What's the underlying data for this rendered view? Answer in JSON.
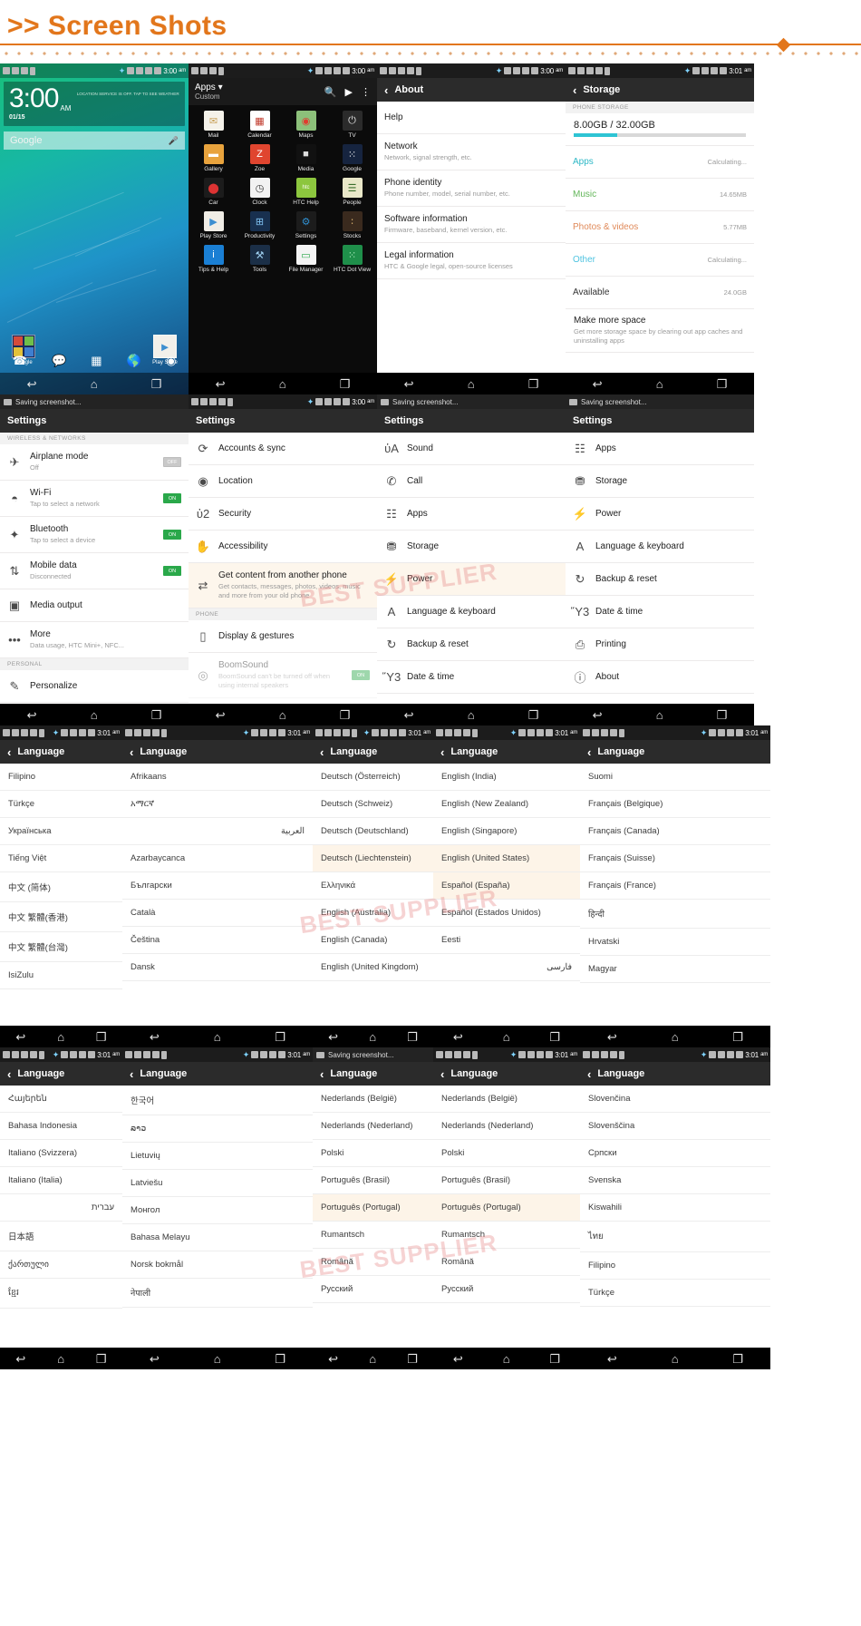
{
  "page": {
    "heading": ">> Screen Shots",
    "chevron": ">>"
  },
  "watermarks": [
    "BEST SUPPLIER",
    "BEST SUPPLIER",
    "BEST SUPPLIER"
  ],
  "status_bar": {
    "time_300": "3:00",
    "time_301": "3:01",
    "ampm": "am"
  },
  "toast": {
    "label": "Saving screenshot..."
  },
  "navbar": {
    "back": "↩",
    "home": "⌂",
    "recent": "❐"
  },
  "home": {
    "clock_time": "3:00",
    "clock_ampm": "AM",
    "clock_date": "01/15",
    "weather_note": "LOCATION SERVICE IS OFF. TAP TO SEE WEATHER",
    "search_placeholder": "Google",
    "mic_icon": "mic-icon",
    "folder_label": "Google",
    "playstore_label": "Play Store",
    "dock": [
      "phone-icon",
      "messages-icon",
      "all-apps-icon",
      "browser-icon",
      "camera-icon"
    ]
  },
  "drawer": {
    "title": "Apps",
    "subtitle": "Custom",
    "caret": "▾",
    "search_icon": "search-icon",
    "store_icon": "play-store-icon",
    "overflow_icon": "overflow-menu-icon",
    "apps": [
      {
        "name": "Mail",
        "color": "#f5f2ea",
        "glyph": "✉",
        "fg": "#c9a25a"
      },
      {
        "name": "Calendar",
        "color": "#ffffff",
        "glyph": "▦",
        "fg": "#c0392b"
      },
      {
        "name": "Maps",
        "color": "#8cc07a",
        "glyph": "◉",
        "fg": "#e03b2f"
      },
      {
        "name": "TV",
        "color": "#2b2b2b",
        "glyph": "⏻",
        "fg": "#e8e8e8"
      },
      {
        "name": "Gallery",
        "color": "#e8a33d",
        "glyph": "▬",
        "fg": "#fff"
      },
      {
        "name": "Zoe",
        "color": "#e0452f",
        "glyph": "Z",
        "fg": "#fff"
      },
      {
        "name": "Media",
        "color": "#111111",
        "glyph": "■",
        "fg": "#dddddd"
      },
      {
        "name": "Google",
        "color": "#16243f",
        "glyph": "⁙",
        "fg": "#ffffff"
      },
      {
        "name": "Car",
        "color": "#1c1c1c",
        "glyph": "⬤",
        "fg": "#d33"
      },
      {
        "name": "Clock",
        "color": "#f2f2f2",
        "glyph": "◷",
        "fg": "#333"
      },
      {
        "name": "HTC Help",
        "color": "#8cc63e",
        "glyph": "htc",
        "fg": "#ffffff"
      },
      {
        "name": "People",
        "color": "#e9e7c8",
        "glyph": "☰",
        "fg": "#3b6e2c"
      },
      {
        "name": "Play Store",
        "color": "#f0ede6",
        "glyph": "▶",
        "fg": "#3c8ed0"
      },
      {
        "name": "Productivity",
        "color": "#18304f",
        "glyph": "⊞",
        "fg": "#7fc1f0"
      },
      {
        "name": "Settings",
        "color": "#1c1c1c",
        "glyph": "⚙",
        "fg": "#2f8fd0"
      },
      {
        "name": "Stocks",
        "color": "#3a2a1e",
        "glyph": "∶",
        "fg": "#cfa86a"
      },
      {
        "name": "Tips & Help",
        "color": "#1a7fd4",
        "glyph": "i",
        "fg": "#ffffff"
      },
      {
        "name": "Tools",
        "color": "#1b2f47",
        "glyph": "⚒",
        "fg": "#9fd0f0"
      },
      {
        "name": "File Manager",
        "color": "#f4f4f4",
        "glyph": "▭",
        "fg": "#2aa84a"
      },
      {
        "name": "HTC Dot View",
        "color": "#1f8f4a",
        "glyph": "⁙",
        "fg": "#b9f5c9"
      }
    ]
  },
  "about_screen": {
    "title": "About",
    "back_icon": "back-chevron-icon",
    "items": [
      {
        "title": "Help",
        "subtitle": ""
      },
      {
        "title": "Network",
        "subtitle": "Network, signal strength, etc."
      },
      {
        "title": "Phone identity",
        "subtitle": "Phone number, model, serial number, etc."
      },
      {
        "title": "Software information",
        "subtitle": "Firmware, baseband, kernel version, etc."
      },
      {
        "title": "Legal information",
        "subtitle": "HTC & Google legal, open-source licenses"
      }
    ]
  },
  "storage_screen": {
    "title": "Storage",
    "back_icon": "back-chevron-icon",
    "section_header": "PHONE STORAGE",
    "usage_label": "8.00GB / 32.00GB",
    "usage_percent": 25,
    "items": [
      {
        "label": "Apps",
        "value": "Calculating...",
        "color": "#2eb8c6"
      },
      {
        "label": "Music",
        "value": "14.65MB",
        "color": "#63b65a"
      },
      {
        "label": "Photos & videos",
        "value": "5.77MB",
        "color": "#e08a5a"
      },
      {
        "label": "Other",
        "value": "Calculating...",
        "color": "#4fc3e0"
      },
      {
        "label": "Available",
        "value": "24.0GB",
        "color": "#333333"
      }
    ],
    "make_space": {
      "title": "Make more space",
      "subtitle": "Get more storage space by clearing out app caches and uninstalling apps"
    }
  },
  "settings_1": {
    "title": "Settings",
    "section_wireless": "WIRELESS & NETWORKS",
    "section_personal": "PERSONAL",
    "items": [
      {
        "icon": "airplane-icon",
        "title": "Airplane mode",
        "subtitle": "Off",
        "toggle": "OFF",
        "on": false
      },
      {
        "icon": "wifi-icon",
        "title": "Wi-Fi",
        "subtitle": "Tap to select a network",
        "toggle": "ON",
        "on": true
      },
      {
        "icon": "bluetooth-icon",
        "title": "Bluetooth",
        "subtitle": "Tap to select a device",
        "toggle": "ON",
        "on": true
      },
      {
        "icon": "mobiledata-icon",
        "title": "Mobile data",
        "subtitle": "Disconnected",
        "toggle": "ON",
        "on": true
      },
      {
        "icon": "mediaoutput-icon",
        "title": "Media output",
        "subtitle": "",
        "toggle": "",
        "on": false
      },
      {
        "icon": "more-icon",
        "title": "More",
        "subtitle": "Data usage, HTC Mini+, NFC...",
        "toggle": "",
        "on": false
      }
    ],
    "personal_items": [
      {
        "icon": "personalize-icon",
        "title": "Personalize",
        "subtitle": ""
      }
    ]
  },
  "settings_2": {
    "title": "Settings",
    "section_phone": "PHONE",
    "items": [
      {
        "icon": "accounts-sync-icon",
        "title": "Accounts & sync",
        "subtitle": ""
      },
      {
        "icon": "location-pin-icon",
        "title": "Location",
        "subtitle": ""
      },
      {
        "icon": "lock-icon",
        "title": "Security",
        "subtitle": ""
      },
      {
        "icon": "hand-icon",
        "title": "Accessibility",
        "subtitle": ""
      },
      {
        "icon": "transfer-icon",
        "title": "Get content from another phone",
        "subtitle": "Get contacts, messages, photos, videos, music and more from your old phone",
        "highlight": true
      }
    ],
    "phone_items": [
      {
        "icon": "display-icon",
        "title": "Display & gestures",
        "subtitle": ""
      },
      {
        "icon": "boomsound-icon",
        "title": "BoomSound",
        "subtitle": "BoomSound can't be turned off when using internal speakers",
        "toggle": "ON",
        "on": true,
        "dim": true
      }
    ]
  },
  "settings_3": {
    "title": "Settings",
    "items": [
      {
        "icon": "sound-icon",
        "title": "Sound"
      },
      {
        "icon": "call-icon",
        "title": "Call"
      },
      {
        "icon": "apps-icon",
        "title": "Apps"
      },
      {
        "icon": "storage-icon",
        "title": "Storage"
      },
      {
        "icon": "power-icon",
        "title": "Power",
        "highlight": true
      },
      {
        "icon": "language-icon",
        "title": "Language & keyboard"
      },
      {
        "icon": "backup-icon",
        "title": "Backup & reset"
      },
      {
        "icon": "datetime-icon",
        "title": "Date & time"
      }
    ]
  },
  "settings_4": {
    "title": "Settings",
    "items": [
      {
        "icon": "apps-icon",
        "title": "Apps"
      },
      {
        "icon": "storage-icon",
        "title": "Storage"
      },
      {
        "icon": "power-icon",
        "title": "Power"
      },
      {
        "icon": "language-icon",
        "title": "Language & keyboard"
      },
      {
        "icon": "backup-icon",
        "title": "Backup & reset"
      },
      {
        "icon": "datetime-icon",
        "title": "Date & time"
      },
      {
        "icon": "printing-icon",
        "title": "Printing"
      },
      {
        "icon": "about-icon",
        "title": "About"
      }
    ]
  },
  "language_screens": [
    {
      "title": "Language",
      "items": [
        "Filipino",
        "Türkçe",
        "Українська",
        "Tiếng Việt",
        "中文 (简体)",
        "中文 繁體(香港)",
        "中文 繁體(台灣)",
        "IsiZulu"
      ]
    },
    {
      "title": "Language",
      "items": [
        "Afrikaans",
        "አማርኛ",
        "العربية",
        "Azarbaycanca",
        "Български",
        "Català",
        "Čeština",
        "Dansk"
      ],
      "rtl_indexes": [
        2
      ]
    },
    {
      "title": "Language",
      "items": [
        "Deutsch (Österreich)",
        "Deutsch (Schweiz)",
        "Deutsch (Deutschland)",
        "Deutsch (Liechtenstein)",
        "Ελληνικά",
        "English (Australia)",
        "English (Canada)",
        "English (United Kingdom)"
      ],
      "highlight_indexes": [
        3
      ]
    },
    {
      "title": "Language",
      "items": [
        "English (India)",
        "English (New Zealand)",
        "English (Singapore)",
        "English (United States)",
        "Español (España)",
        "Español (Estados Unidos)",
        "Eesti",
        "فارسی"
      ],
      "highlight_indexes": [
        3,
        4
      ],
      "rtl_indexes": [
        7
      ]
    },
    {
      "title": "Language",
      "items": [
        "Suomi",
        "Français (Belgique)",
        "Français (Canada)",
        "Français (Suisse)",
        "Français (France)",
        "हिन्दी",
        "Hrvatski",
        "Magyar"
      ]
    },
    {
      "title": "Language",
      "items": [
        "Հայերեն",
        "Bahasa Indonesia",
        "Italiano (Svizzera)",
        "Italiano (Italia)",
        "עברית",
        "日本語",
        "ქართული",
        "ខ្មែរ"
      ],
      "rtl_indexes": [
        4
      ]
    },
    {
      "title": "Language",
      "items": [
        "한국어",
        "ລາວ",
        "Lietuvių",
        "Latviešu",
        "Монгол",
        "Bahasa Melayu",
        "Norsk bokmål",
        "नेपाली"
      ]
    },
    {
      "title": "Language",
      "items": [
        "Nederlands (België)",
        "Nederlands (Nederland)",
        "Polski",
        "Português (Brasil)",
        "Português (Portugal)",
        "Rumantsch",
        "Română",
        "Русский"
      ],
      "highlight_indexes": [
        4
      ]
    },
    {
      "title": "Language",
      "items": [
        "Nederlands (België)",
        "Nederlands (Nederland)",
        "Polski",
        "Português (Brasil)",
        "Português (Portugal)",
        "Rumantsch",
        "Română",
        "Русский"
      ],
      "highlight_indexes": [
        4
      ]
    },
    {
      "title": "Language",
      "items": [
        "Slovenčina",
        "Slovenščina",
        "Српски",
        "Svenska",
        "Kiswahili",
        "ไทย",
        "Filipino",
        "Türkçe"
      ]
    }
  ]
}
